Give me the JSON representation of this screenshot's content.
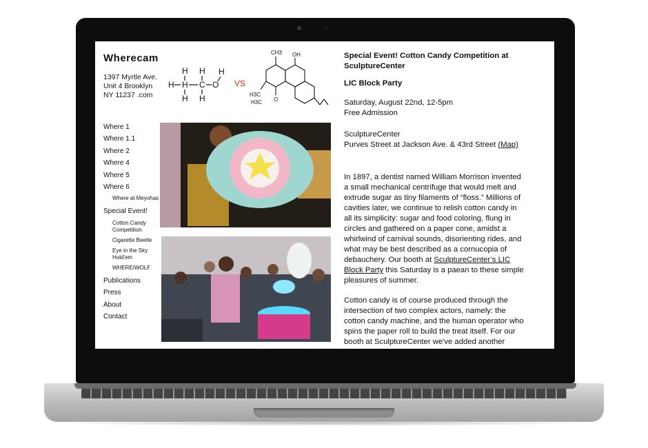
{
  "site": {
    "logo": "Wherecam",
    "address": [
      "1397 Myrtle Ave.",
      "Unit 4 Brooklyn",
      "NY 11237 .com"
    ]
  },
  "nav": {
    "items": [
      {
        "label": "Where 1",
        "level": 1
      },
      {
        "label": "Where 1.1",
        "level": 1
      },
      {
        "label": "Where 2",
        "level": 1
      },
      {
        "label": "Where 4",
        "level": 1
      },
      {
        "label": "Where 5",
        "level": 1
      },
      {
        "label": "Where 6",
        "level": 1
      },
      {
        "label": "Where at Meyohas",
        "level": 2
      },
      {
        "label": "Special Event!",
        "level": 1
      },
      {
        "label": "Cotton Candy Competition",
        "level": 2
      },
      {
        "label": "Cigarette Beetle",
        "level": 2
      },
      {
        "label": "Eye in the Sky Hold'em",
        "level": 2
      },
      {
        "label": "WHERE/WOLF",
        "level": 2
      },
      {
        "label": "Publications",
        "level": 1
      },
      {
        "label": "Press",
        "level": 1
      },
      {
        "label": "About",
        "level": 1
      },
      {
        "label": "Contact",
        "level": 1
      }
    ]
  },
  "molecule": {
    "vs": "VS",
    "vs_color": "#d22a2a",
    "atoms": {
      "h": "H",
      "c": "C",
      "o": "O",
      "oh": "OH",
      "ch3": "CH3",
      "h3c": "H3C"
    }
  },
  "article": {
    "title": "Special Event! Cotton Candy Competition at SculptureCenter",
    "subtitle": "LIC Block Party",
    "date": "Saturday, August 22nd, 12-5pm",
    "admission": "Free Admission",
    "venue": "SculptureCenter",
    "venue_address": "Purves Street at Jackson Ave. & 43rd Street",
    "map_link": "(Map)",
    "p1_before": "In 1897, a dentist named William Morrison invented a small mechanical centrifuge that would melt and extrude sugar as tiny filaments of “floss.” Millions of cavities later, we continue to relish cotton candy in all its simplicity: sugar and food coloring, flung in circles and gathered on a paper cone, amidst a whirlwind of carnival sounds, disorienting rides, and what may be best described as a cornucopia of debauchery. Our booth at",
    "p1_link": "SculptureCenter’s LIC Block Party",
    "p1_after": "this Saturday is a paean to these simple pleasures of summer.",
    "p2": "Cotton candy is of course produced through the intersection of two complex actors, namely: the cotton candy machine, and the human operator who spins the paper roll to build the treat itself. For our booth at SculptureCenter we've added another"
  }
}
